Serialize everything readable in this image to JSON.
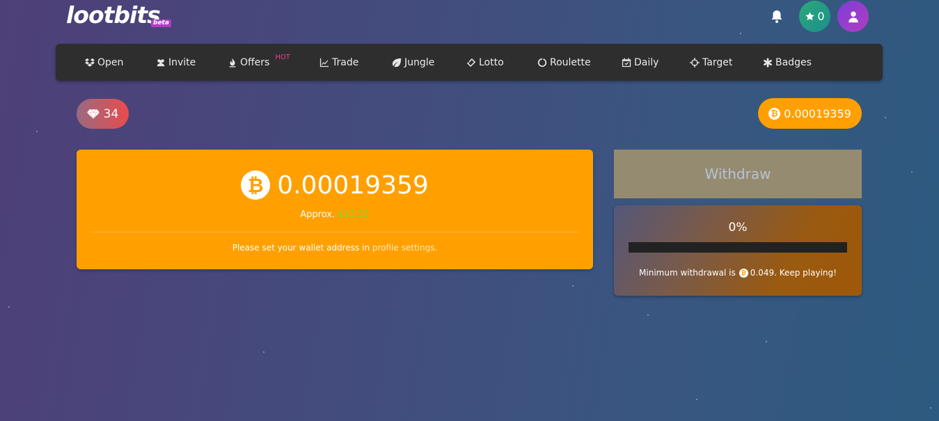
{
  "header": {
    "logo_text": "lootbits",
    "logo_badge": "beta",
    "stars_count": "0"
  },
  "nav": {
    "items": [
      {
        "label": "Open",
        "icon": "dropbox-icon"
      },
      {
        "label": "Invite",
        "icon": "users-icon"
      },
      {
        "label": "Offers",
        "icon": "fire-icon",
        "badge": "HOT"
      },
      {
        "label": "Trade",
        "icon": "chart-line-icon"
      },
      {
        "label": "Jungle",
        "icon": "leaf-icon"
      },
      {
        "label": "Lotto",
        "icon": "ticket-icon"
      },
      {
        "label": "Roulette",
        "icon": "circle-notch-icon"
      },
      {
        "label": "Daily",
        "icon": "calendar-check-icon"
      },
      {
        "label": "Target",
        "icon": "crosshairs-icon"
      },
      {
        "label": "Badges",
        "icon": "asterisk-icon"
      }
    ]
  },
  "gems": {
    "count": "34"
  },
  "balance_pill": {
    "value": "0.00019359"
  },
  "main": {
    "balance": "0.00019359",
    "approx_label": "Approx.",
    "approx_usd": "$11.31",
    "wallet_note_prefix": "Please set your wallet address in",
    "wallet_note_link": "profile settings."
  },
  "withdraw": {
    "button_label": "Withdraw",
    "progress_pct": "0%",
    "progress_value": 0,
    "min_note_prefix": "Minimum withdrawal is",
    "min_note_suffix": "0.049. Keep playing!"
  },
  "colors": {
    "accent": "#ffa000",
    "nav_bg": "#2e2e2e",
    "usd_green": "#7fd633",
    "hot_pink": "#e9408c"
  }
}
